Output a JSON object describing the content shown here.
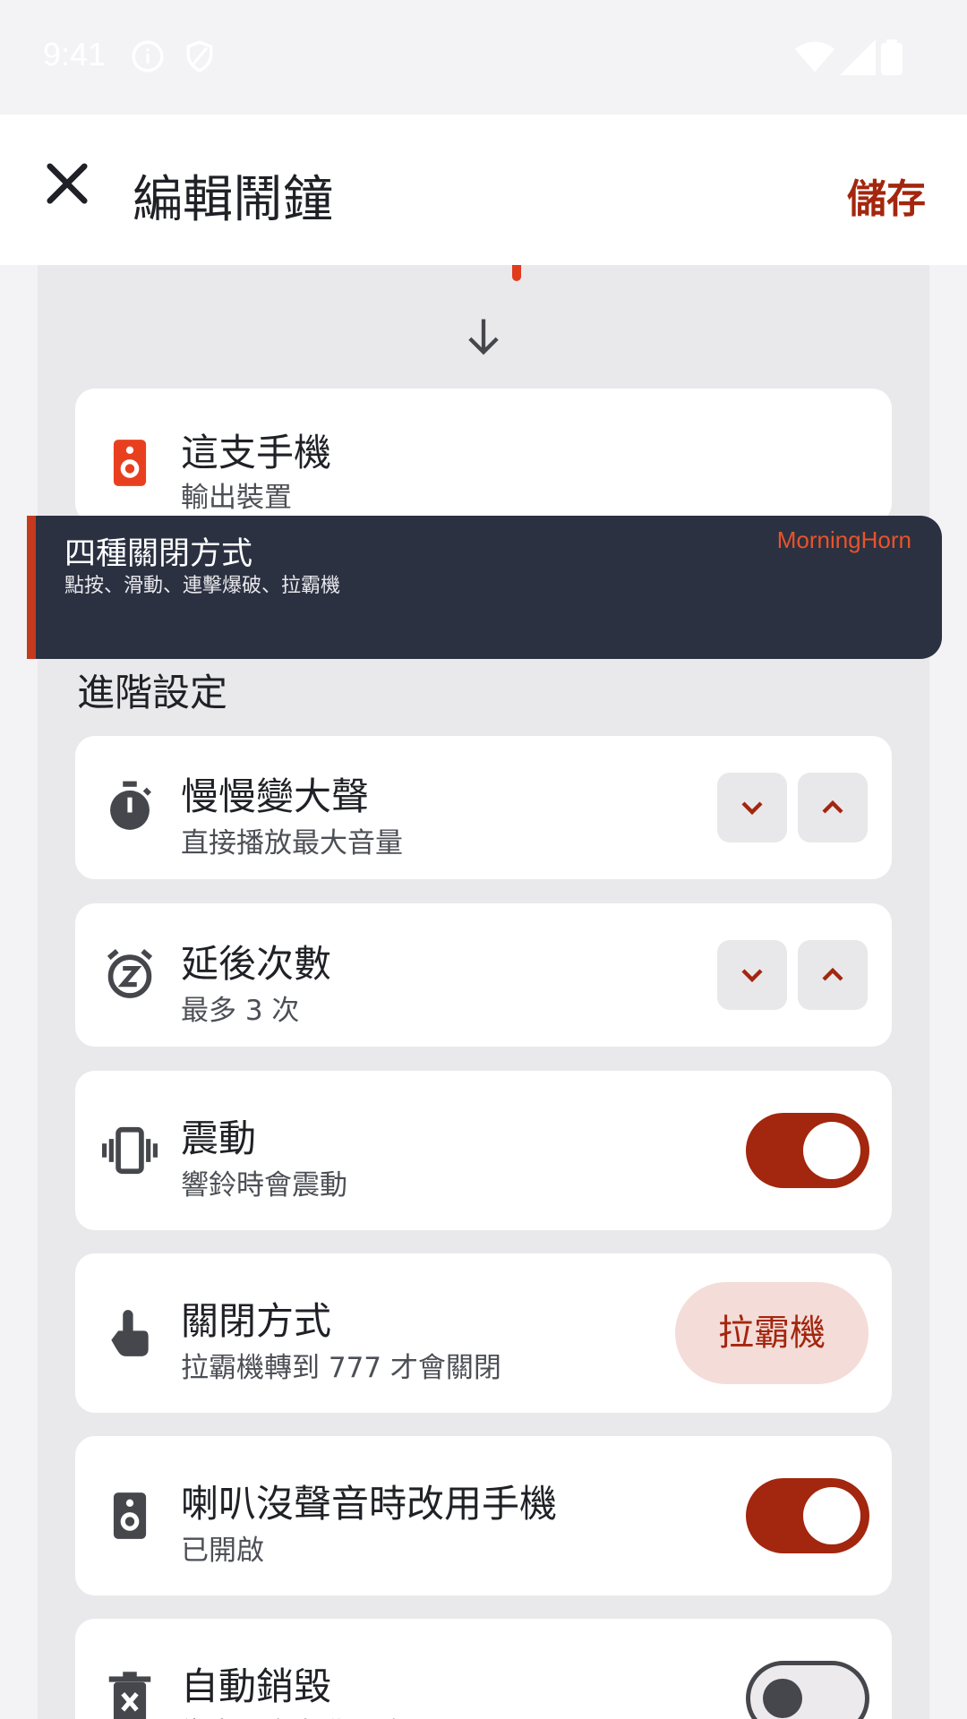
{
  "status_bar": {
    "time": "9:41"
  },
  "app_bar": {
    "title": "編輯鬧鐘",
    "save_label": "儲存"
  },
  "device_card": {
    "title": "這支手機",
    "subtitle": "輸出裝置"
  },
  "toast": {
    "title": "四種關閉方式",
    "subtitle": "點按、滑動、連擊爆破、拉霸機",
    "brand": "MorningHorn"
  },
  "section": {
    "label": "進階設定"
  },
  "settings": [
    {
      "title": "慢慢變大聲",
      "subtitle": "直接播放最大音量",
      "control": "stepper"
    },
    {
      "title": "延後次數",
      "subtitle": "最多 3 次",
      "control": "stepper"
    },
    {
      "title": "震動",
      "subtitle": "響鈴時會震動",
      "control": "toggle",
      "on": true
    },
    {
      "title": "關閉方式",
      "subtitle": "拉霸機轉到 777 才會關閉",
      "control": "pill",
      "value": "拉霸機"
    },
    {
      "title": "喇叭沒聲音時改用手機",
      "subtitle": "已開啟",
      "control": "toggle",
      "on": true
    },
    {
      "title": "自動銷毀",
      "subtitle": "響完不會自動刪除",
      "control": "toggle",
      "on": false
    }
  ],
  "colors": {
    "accent": "#a3260e",
    "toast_bg": "#2b3141",
    "brand": "#e8532b"
  }
}
